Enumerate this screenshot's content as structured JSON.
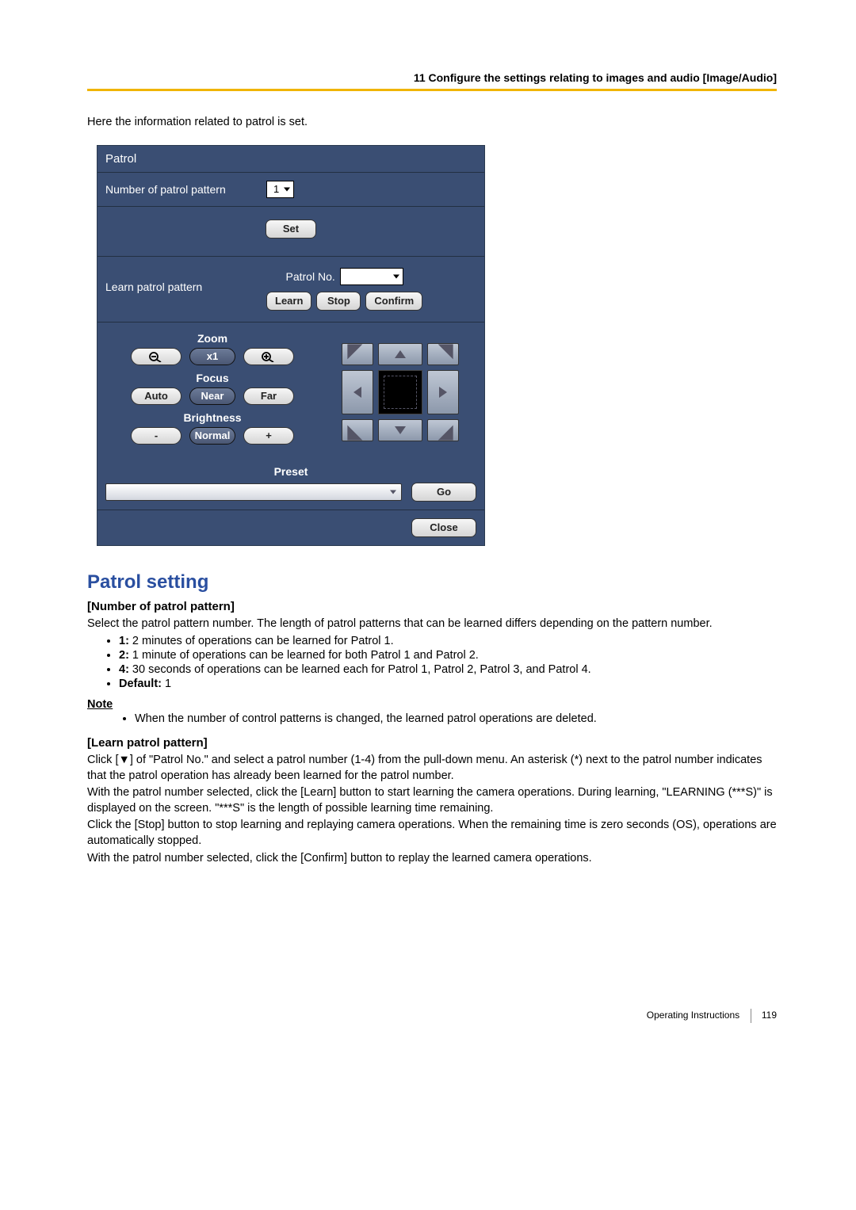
{
  "header": "11 Configure the settings relating to images and audio [Image/Audio]",
  "intro": "Here the information related to patrol is set.",
  "panel": {
    "title": "Patrol",
    "num_label": "Number of patrol pattern",
    "num_value": "1",
    "set_btn": "Set",
    "learn_label": "Learn patrol pattern",
    "patrol_no_label": "Patrol No.",
    "learn_btn": "Learn",
    "stop_btn": "Stop",
    "confirm_btn": "Confirm",
    "zoom": {
      "title": "Zoom",
      "mid": "x1"
    },
    "focus": {
      "title": "Focus",
      "auto": "Auto",
      "near": "Near",
      "far": "Far"
    },
    "brightness": {
      "title": "Brightness",
      "minus": "-",
      "normal": "Normal",
      "plus": "+"
    },
    "preset": {
      "title": "Preset",
      "go": "Go"
    },
    "close": "Close"
  },
  "content": {
    "h2": "Patrol setting",
    "num": {
      "title": "[Number of patrol pattern]",
      "desc": "Select the patrol pattern number. The length of patrol patterns that can be learned differs depending on the pattern number.",
      "b1": {
        "k": "1:",
        "v": " 2 minutes of operations can be learned for Patrol 1."
      },
      "b2": {
        "k": "2:",
        "v": " 1 minute of operations can be learned for both Patrol 1 and Patrol 2."
      },
      "b3": {
        "k": "4:",
        "v": " 30 seconds of operations can be learned each for Patrol 1, Patrol 2, Patrol 3, and Patrol 4."
      },
      "b4": {
        "k": "Default:",
        "v": " 1"
      }
    },
    "note_hdr": "Note",
    "note_item": "When the number of control patterns is changed, the learned patrol operations are deleted.",
    "learn": {
      "title": "[Learn patrol pattern]",
      "p1": "Click [▼] of \"Patrol No.\" and select a patrol number (1-4) from the pull-down menu. An asterisk (*) next to the patrol number indicates that the patrol operation has already been learned for the patrol number.",
      "p2": "With the patrol number selected, click the [Learn] button to start learning the camera operations. During learning, \"LEARNING (***S)\" is displayed on the screen. \"***S\" is the length of possible learning time remaining.",
      "p3": "Click the [Stop] button to stop learning and replaying camera operations. When the remaining time is zero seconds (OS), operations are automatically stopped.",
      "p4": "With the patrol number selected, click the [Confirm] button to replay the learned camera operations."
    }
  },
  "footer": {
    "label": "Operating Instructions",
    "page": "119"
  }
}
